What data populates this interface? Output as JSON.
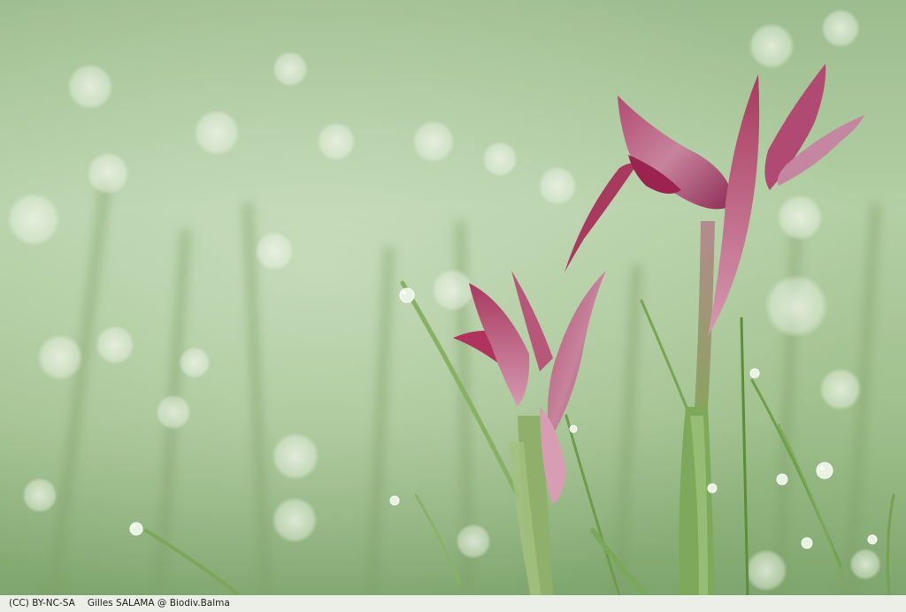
{
  "photo": {
    "license": "(CC) BY-NC-SA",
    "credit": "Gilles SALAMA @ Biodiv.Balma"
  }
}
